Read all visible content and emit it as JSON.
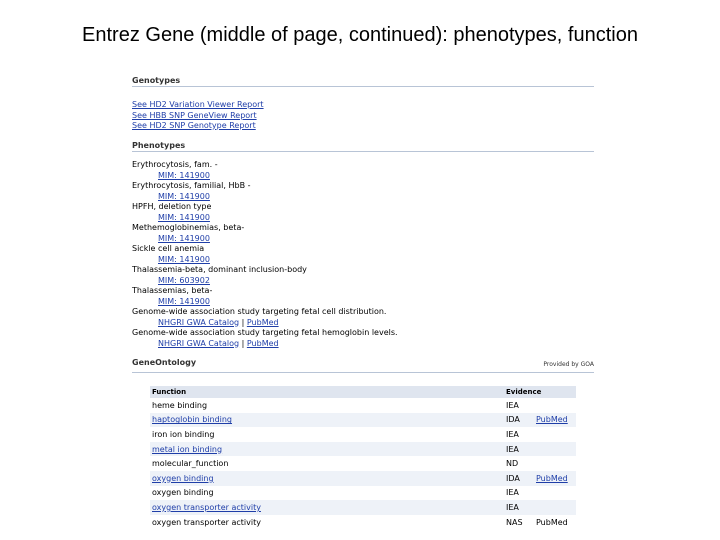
{
  "slide_title": "Entrez Gene (middle of page, continued): phenotypes, function",
  "genotypes": {
    "heading": "Genotypes",
    "links": [
      "See HD2 Variation Viewer Report",
      "See HBB SNP GeneView Report",
      "See HD2 SNP Genotype Report"
    ]
  },
  "phenotypes": {
    "heading": "Phenotypes",
    "items": [
      {
        "name": "Erythrocytosis, fam. -",
        "links": [
          "MIM: 141900"
        ]
      },
      {
        "name": "Erythrocytosis, familial, HbB -",
        "links": [
          "MIM: 141900"
        ]
      },
      {
        "name": "HPFH, deletion type",
        "links": [
          "MIM: 141900"
        ]
      },
      {
        "name": "Methemoglobinemias, beta-",
        "links": [
          "MIM: 141900"
        ]
      },
      {
        "name": "Sickle cell anemia",
        "links": [
          "MIM: 141900"
        ]
      },
      {
        "name": "Thalassemia-beta, dominant inclusion-body",
        "links": [
          "MIM: 603902"
        ]
      },
      {
        "name": "Thalassemias, beta-",
        "links": [
          "MIM: 141900"
        ]
      },
      {
        "name": "Genome-wide association study targeting fetal cell distribution.",
        "links": [
          "NHGRI GWA Catalog",
          "PubMed"
        ]
      },
      {
        "name": "Genome-wide association study targeting fetal hemoglobin levels.",
        "links": [
          "NHGRI GWA Catalog",
          "PubMed"
        ]
      }
    ]
  },
  "gene_ontology": {
    "heading": "GeneOntology",
    "provided_by": "Provided by GOA",
    "columns": {
      "function": "Function",
      "evidence": "Evidence"
    },
    "rows": [
      {
        "function": "heme binding",
        "link": false,
        "evidence": "IEA",
        "pubmed": ""
      },
      {
        "function": "haptoglobin binding",
        "link": true,
        "evidence": "IDA",
        "pubmed": "PubMed"
      },
      {
        "function": "iron ion binding",
        "link": false,
        "evidence": "IEA",
        "pubmed": ""
      },
      {
        "function": "metal ion binding",
        "link": true,
        "evidence": "IEA",
        "pubmed": ""
      },
      {
        "function": "molecular_function",
        "link": false,
        "evidence": "ND",
        "pubmed": ""
      },
      {
        "function": "oxygen binding",
        "link": true,
        "evidence": "IDA",
        "pubmed": "PubMed"
      },
      {
        "function": "oxygen binding",
        "link": false,
        "evidence": "IEA",
        "pubmed": ""
      },
      {
        "function": "oxygen transporter activity",
        "link": true,
        "evidence": "IEA",
        "pubmed": ""
      },
      {
        "function": "oxygen transporter activity",
        "link": false,
        "evidence": "NAS",
        "pubmed": "PubMed"
      }
    ]
  }
}
